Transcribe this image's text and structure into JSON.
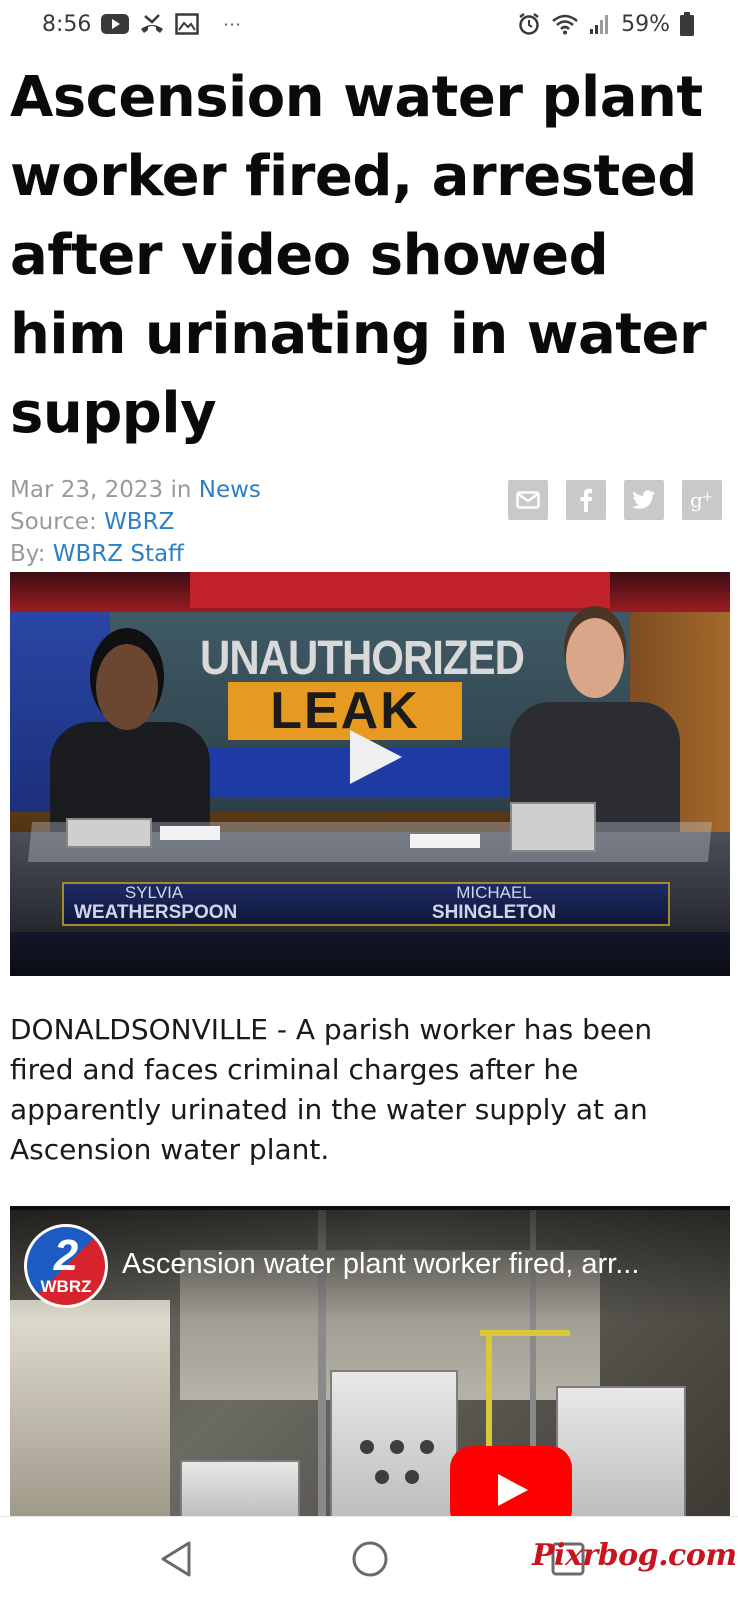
{
  "status_bar": {
    "time": "8:56",
    "overflow": "···",
    "battery": "59%",
    "left_icons": [
      "youtube-icon",
      "missed-call-icon",
      "gallery-icon"
    ],
    "right_icons": [
      "alarm-icon",
      "wifi-icon",
      "signal-icon",
      "battery-icon"
    ]
  },
  "article": {
    "headline": "Ascension water plant worker fired, arrested after video showed him urinating in water supply",
    "date": "Mar 23, 2023",
    "in_label": "in",
    "category": "News",
    "source_label": "Source:",
    "source": "WBRZ",
    "by_label": "By:",
    "author": "WBRZ Staff",
    "share_buttons": [
      "email-icon",
      "facebook-icon",
      "twitter-icon",
      "google-plus-icon"
    ],
    "body": "DONALDSONVILLE - A parish worker has been fired and faces criminal charges after he apparently urinated in the water supply at an Ascension water plant."
  },
  "video1": {
    "graphic_line1": "UNAUTHORIZED",
    "graphic_line2": "LEAK",
    "anchor_left_first": "SYLVIA",
    "anchor_left_last": "WEATHERSPOON",
    "anchor_right_first": "MICHAEL",
    "anchor_right_last": "SHINGLETON"
  },
  "video2": {
    "channel_number": "2",
    "channel_name": "WBRZ",
    "title": "Ascension water plant worker fired, arr..."
  },
  "nav_bar": {
    "buttons": [
      "back-icon",
      "home-icon",
      "recents-icon"
    ]
  },
  "watermark": "Pixrbog.com",
  "colors": {
    "link": "#2f7fc4",
    "meta_gray": "#9a9a9a",
    "share_gray": "#c9c9c9",
    "youtube_red": "#ff0000",
    "watermark_red": "#c8141e"
  }
}
